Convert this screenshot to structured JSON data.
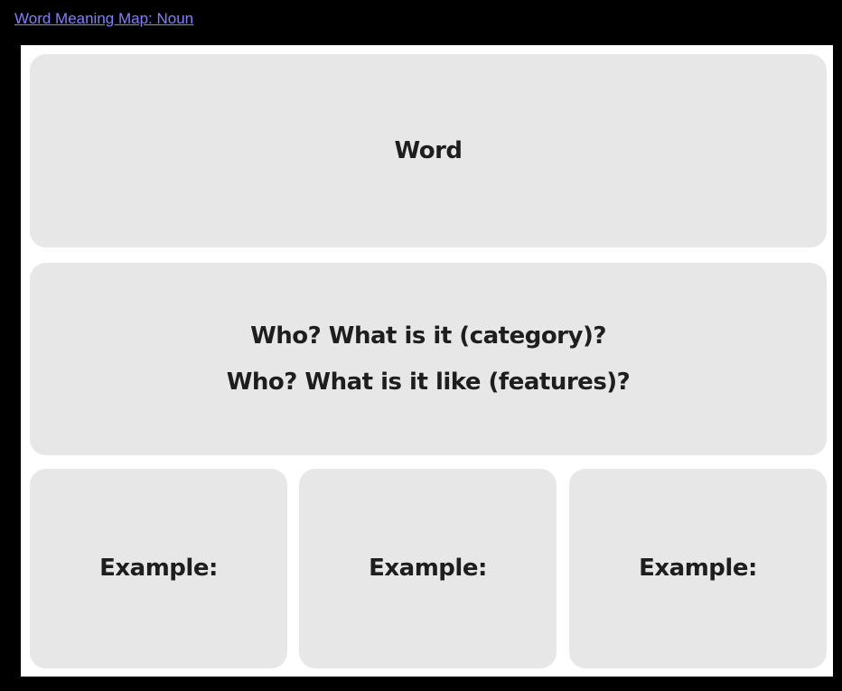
{
  "title_link": "Word Meaning Map: Noun",
  "map": {
    "word_label": "Word",
    "questions": [
      "Who? What is it (category)?",
      "Who? What is it like (features)?"
    ],
    "examples": [
      "Example:",
      "Example:",
      "Example:"
    ]
  }
}
